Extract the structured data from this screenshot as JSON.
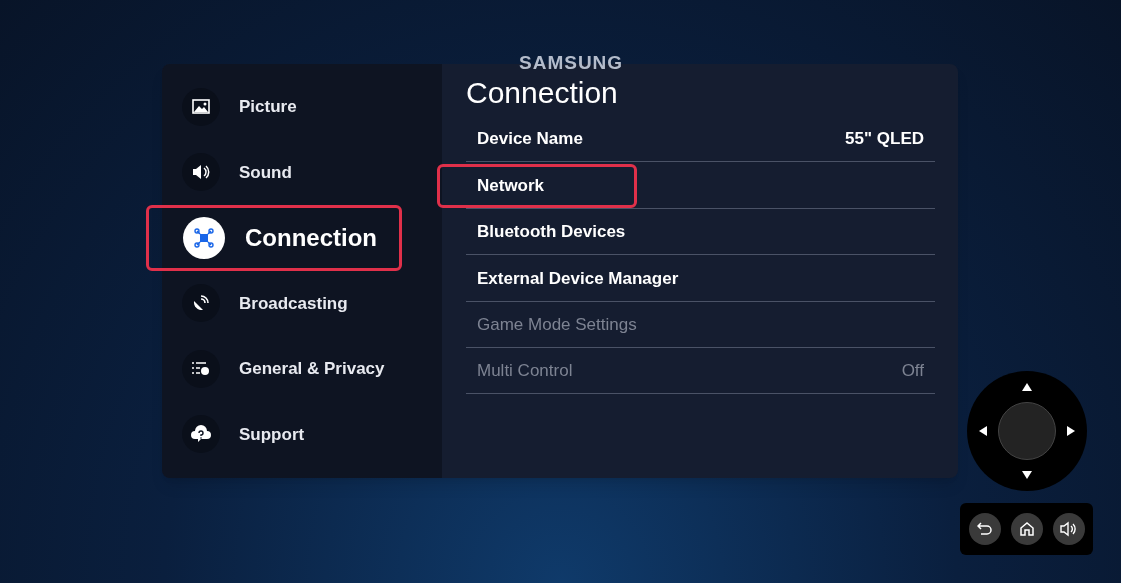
{
  "brand": "SAMSUNG",
  "sidebar": {
    "items": [
      {
        "label": "Picture",
        "kind": "picture",
        "selected": false,
        "highlighted": false
      },
      {
        "label": "Sound",
        "kind": "sound",
        "selected": false,
        "highlighted": false
      },
      {
        "label": "Connection",
        "kind": "connection",
        "selected": true,
        "highlighted": true
      },
      {
        "label": "Broadcasting",
        "kind": "broadcast",
        "selected": false,
        "highlighted": false
      },
      {
        "label": "General & Privacy",
        "kind": "general",
        "selected": false,
        "highlighted": false
      },
      {
        "label": "Support",
        "kind": "support",
        "selected": false,
        "highlighted": false
      }
    ]
  },
  "panel": {
    "title": "Connection",
    "items": [
      {
        "label": "Device Name",
        "value": "55\" QLED",
        "disabled": false,
        "highlighted": false
      },
      {
        "label": "Network",
        "disabled": false,
        "highlighted": true
      },
      {
        "label": "Bluetooth Devices",
        "disabled": false,
        "highlighted": false
      },
      {
        "label": "External Device Manager",
        "disabled": false,
        "highlighted": false
      },
      {
        "label": "Game Mode Settings",
        "disabled": true,
        "highlighted": false
      },
      {
        "label": "Multi Control",
        "value": "Off",
        "disabled": true,
        "highlighted": false
      }
    ]
  }
}
